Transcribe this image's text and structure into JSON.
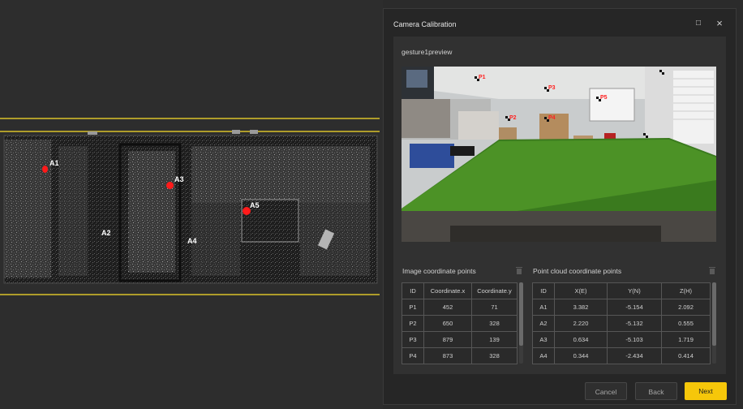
{
  "cloud_labels": [
    "A1",
    "A2",
    "A3",
    "A4",
    "A5"
  ],
  "dialog": {
    "title": "Camera Calibration",
    "maximize_icon": "□",
    "close_icon": "×",
    "preview_title": "gesture1preview",
    "preview_points": [
      "P1",
      "P2",
      "P3",
      "P4",
      "P5"
    ],
    "image_points": {
      "title": "Image coordinate points",
      "headers": [
        "ID",
        "Coordinate.x",
        "Coordinate.y"
      ],
      "rows": [
        [
          "P1",
          "452",
          "71"
        ],
        [
          "P2",
          "650",
          "328"
        ],
        [
          "P3",
          "879",
          "139"
        ],
        [
          "P4",
          "873",
          "328"
        ]
      ]
    },
    "cloud_points": {
      "title": "Point cloud coordinate points",
      "headers": [
        "ID",
        "X(E)",
        "Y(N)",
        "Z(H)"
      ],
      "rows": [
        [
          "A1",
          "3.382",
          "-5.154",
          "2.092"
        ],
        [
          "A2",
          "2.220",
          "-5.132",
          "0.555"
        ],
        [
          "A3",
          "0.634",
          "-5.103",
          "1.719"
        ],
        [
          "A4",
          "0.344",
          "-2.434",
          "0.414"
        ]
      ]
    },
    "buttons": {
      "cancel": "Cancel",
      "back": "Back",
      "next": "Next"
    }
  },
  "colors": {
    "accent": "#f6c70a",
    "marker": "#ff1a1a",
    "track_line": "#d9c12a"
  }
}
